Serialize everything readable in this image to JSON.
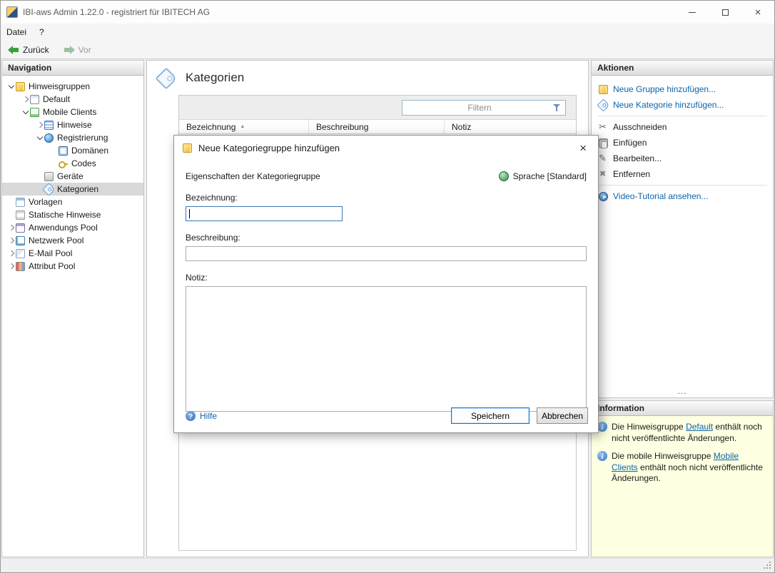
{
  "window": {
    "title": "IBI-aws Admin 1.22.0 - registriert für IBITECH AG"
  },
  "menubar": {
    "items": [
      {
        "label": "Datei"
      },
      {
        "label": "?"
      }
    ]
  },
  "toolbar": {
    "back_label": "Zurück",
    "forward_label": "Vor"
  },
  "navigation": {
    "header": "Navigation",
    "tree": [
      {
        "label": "Hinweisgruppen",
        "level": 0,
        "state": "expanded",
        "icon": "group",
        "selected": false
      },
      {
        "label": "Default",
        "level": 1,
        "state": "collapsed",
        "icon": "notice-default",
        "selected": false
      },
      {
        "label": "Mobile Clients",
        "level": 1,
        "state": "expanded",
        "icon": "mobile-client",
        "selected": false
      },
      {
        "label": "Hinweise",
        "level": 2,
        "state": "collapsed",
        "icon": "notices",
        "selected": false
      },
      {
        "label": "Registrierung",
        "level": 2,
        "state": "expanded",
        "icon": "registration",
        "selected": false
      },
      {
        "label": "Domänen",
        "level": 3,
        "state": "leaf",
        "icon": "domain",
        "selected": false
      },
      {
        "label": "Codes",
        "level": 3,
        "state": "leaf",
        "icon": "key",
        "selected": false
      },
      {
        "label": "Geräte",
        "level": 2,
        "state": "leaf",
        "icon": "devices",
        "selected": false
      },
      {
        "label": "Kategorien",
        "level": 2,
        "state": "leaf",
        "icon": "categories",
        "selected": true
      },
      {
        "label": "Vorlagen",
        "level": 0,
        "state": "leaf",
        "icon": "templates",
        "selected": false
      },
      {
        "label": "Statische Hinweise",
        "level": 0,
        "state": "leaf",
        "icon": "static-notices",
        "selected": false
      },
      {
        "label": "Anwendungs Pool",
        "level": 0,
        "state": "collapsed",
        "icon": "app-pool",
        "selected": false
      },
      {
        "label": "Netzwerk Pool",
        "level": 0,
        "state": "collapsed",
        "icon": "network-pool",
        "selected": false
      },
      {
        "label": "E-Mail Pool",
        "level": 0,
        "state": "collapsed",
        "icon": "email-pool",
        "selected": false
      },
      {
        "label": "Attribut Pool",
        "level": 0,
        "state": "collapsed",
        "icon": "attribute-pool",
        "selected": false
      }
    ]
  },
  "main": {
    "title": "Kategorien",
    "filter": {
      "placeholder": "Filtern",
      "value": ""
    },
    "table": {
      "columns": [
        {
          "label": "Bezeichnung",
          "sorted": "asc"
        },
        {
          "label": "Beschreibung",
          "sorted": ""
        },
        {
          "label": "Notiz",
          "sorted": ""
        }
      ],
      "rows": []
    }
  },
  "dialog": {
    "title": "Neue Kategoriegruppe hinzufügen",
    "section_title": "Eigenschaften der Kategoriegruppe",
    "language_label": "Sprache [Standard]",
    "fields": {
      "bezeichnung_label": "Bezeichnung:",
      "bezeichnung_value": "",
      "beschreibung_label": "Beschreibung:",
      "beschreibung_value": "",
      "notiz_label": "Notiz:",
      "notiz_value": ""
    },
    "help_label": "Hilfe",
    "save_label": "Speichern",
    "cancel_label": "Abbrechen"
  },
  "actions": {
    "header": "Aktionen",
    "items": [
      {
        "label": "Neue Gruppe hinzufügen...",
        "icon": "new-group",
        "style": "link",
        "separator_after": false
      },
      {
        "label": "Neue Kategorie hinzufügen...",
        "icon": "new-category",
        "style": "link",
        "separator_after": true
      },
      {
        "label": "Ausschneiden",
        "icon": "cut",
        "style": "normal",
        "separator_after": false
      },
      {
        "label": "Einfügen",
        "icon": "paste",
        "style": "normal",
        "separator_after": false
      },
      {
        "label": "Bearbeiten...",
        "icon": "edit",
        "style": "normal",
        "separator_after": false
      },
      {
        "label": "Entfernen",
        "icon": "remove",
        "style": "normal",
        "separator_after": true
      },
      {
        "label": "Video-Tutorial ansehen...",
        "icon": "video",
        "style": "link",
        "separator_after": false
      }
    ],
    "overflow_indicator": "..."
  },
  "information": {
    "header": "Information",
    "items": [
      {
        "prefix": "Die Hinweisgruppe ",
        "link": "Default",
        "suffix": " enthält noch nicht veröffentlichte Änderungen."
      },
      {
        "prefix": "Die mobile Hinweisgruppe ",
        "link": "Mobile Clients",
        "suffix": " enthält noch nicht veröffentlichte Änderungen."
      }
    ]
  },
  "colors": {
    "link_blue": "#0a64ad",
    "info_background": "#ffffe1",
    "primary_button_border": "#0078d7",
    "tree_selection": "#d9d9d9",
    "back_arrow_green": "#3aa13a"
  }
}
